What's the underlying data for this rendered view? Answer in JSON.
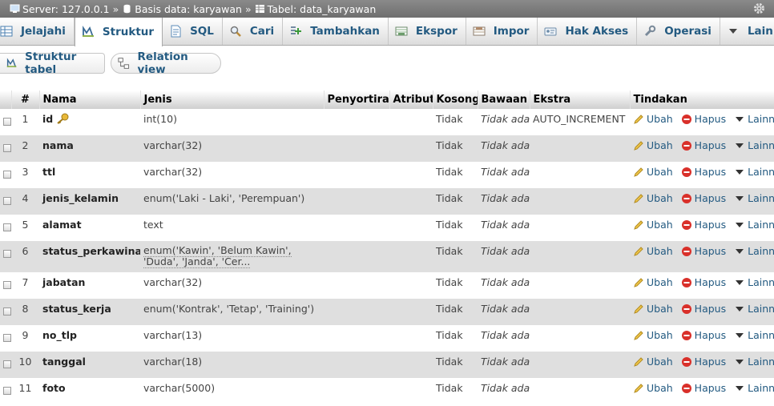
{
  "breadcrumb": {
    "server": "Server: 127.0.0.1",
    "database": "Basis data: karyawan",
    "table": "Tabel: data_karyawan",
    "separator": "»"
  },
  "tabs": [
    {
      "label": "Jelajahi",
      "icon": "browse-icon"
    },
    {
      "label": "Struktur",
      "icon": "structure-icon",
      "active": true
    },
    {
      "label": "SQL",
      "icon": "sql-icon"
    },
    {
      "label": "Cari",
      "icon": "search-icon"
    },
    {
      "label": "Tambahkan",
      "icon": "insert-icon"
    },
    {
      "label": "Ekspor",
      "icon": "export-icon"
    },
    {
      "label": "Impor",
      "icon": "import-icon"
    },
    {
      "label": "Hak Akses",
      "icon": "privileges-icon"
    },
    {
      "label": "Operasi",
      "icon": "wrench-icon"
    },
    {
      "label": "Lainnya",
      "icon": "chevron-down-icon"
    }
  ],
  "subnav": {
    "struktur_tabel": "Struktur tabel",
    "relation_view": "Relation view"
  },
  "table": {
    "headers": {
      "idx": "#",
      "nama": "Nama",
      "jenis": "Jenis",
      "penyortiran": "Penyortiran",
      "atribut": "Atribut",
      "kosong": "Kosong",
      "bawaan": "Bawaan",
      "ekstra": "Ekstra",
      "tindakan": "Tindakan"
    },
    "actions": {
      "ubah": "Ubah",
      "hapus": "Hapus",
      "lainnya": "Lainnya"
    },
    "rows": [
      {
        "idx": "1",
        "nama": "id",
        "jenis": "int(10)",
        "kosong": "Tidak",
        "bawaan": "Tidak ada",
        "ekstra": "AUTO_INCREMENT",
        "primary": true
      },
      {
        "idx": "2",
        "nama": "nama",
        "jenis": "varchar(32)",
        "kosong": "Tidak",
        "bawaan": "Tidak ada",
        "ekstra": ""
      },
      {
        "idx": "3",
        "nama": "ttl",
        "jenis": "varchar(32)",
        "kosong": "Tidak",
        "bawaan": "Tidak ada",
        "ekstra": ""
      },
      {
        "idx": "4",
        "nama": "jenis_kelamin",
        "jenis": "enum('Laki - Laki', 'Perempuan')",
        "kosong": "Tidak",
        "bawaan": "Tidak ada",
        "ekstra": ""
      },
      {
        "idx": "5",
        "nama": "alamat",
        "jenis": "text",
        "kosong": "Tidak",
        "bawaan": "Tidak ada",
        "ekstra": ""
      },
      {
        "idx": "6",
        "nama": "status_perkawinan",
        "jenis": "enum('Kawin', 'Belum Kawin', 'Duda', 'Janda', 'Cer...",
        "kosong": "Tidak",
        "bawaan": "Tidak ada",
        "ekstra": "",
        "wrap": true
      },
      {
        "idx": "7",
        "nama": "jabatan",
        "jenis": "varchar(32)",
        "kosong": "Tidak",
        "bawaan": "Tidak ada",
        "ekstra": ""
      },
      {
        "idx": "8",
        "nama": "status_kerja",
        "jenis": "enum('Kontrak', 'Tetap', 'Training')",
        "kosong": "Tidak",
        "bawaan": "Tidak ada",
        "ekstra": ""
      },
      {
        "idx": "9",
        "nama": "no_tlp",
        "jenis": "varchar(13)",
        "kosong": "Tidak",
        "bawaan": "Tidak ada",
        "ekstra": ""
      },
      {
        "idx": "10",
        "nama": "tanggal",
        "jenis": "varchar(18)",
        "kosong": "Tidak",
        "bawaan": "Tidak ada",
        "ekstra": ""
      },
      {
        "idx": "11",
        "nama": "foto",
        "jenis": "varchar(5000)",
        "kosong": "Tidak",
        "bawaan": "Tidak ada",
        "ekstra": ""
      }
    ]
  },
  "colors": {
    "link": "#235a81",
    "row_even": "#dfdfdf",
    "breadcrumb_bg": "#7b7b7b",
    "hapus_red": "#d9302a",
    "key_gold": "#d6a21d"
  }
}
